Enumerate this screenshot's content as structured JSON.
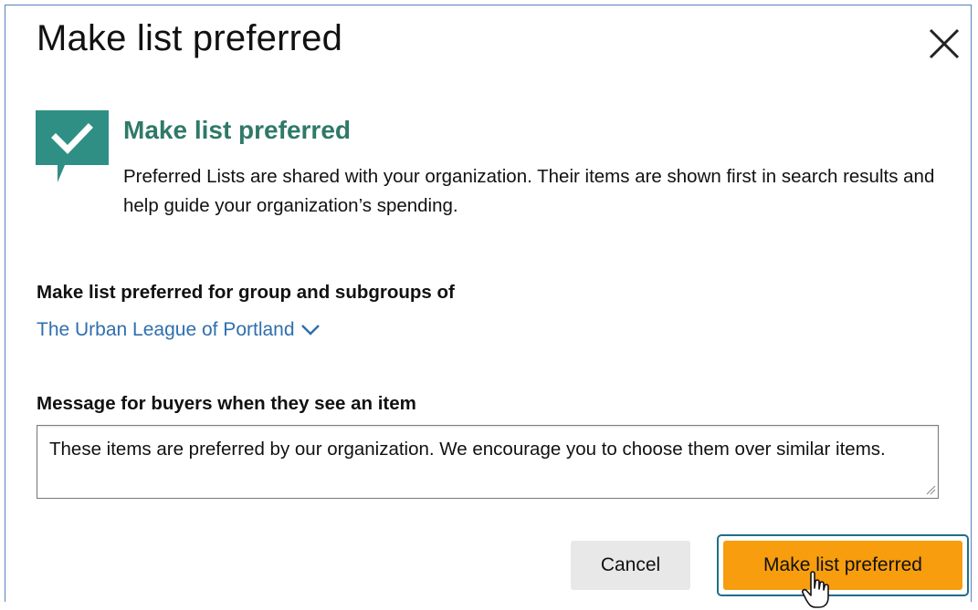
{
  "dialog": {
    "title": "Make list preferred"
  },
  "alert": {
    "icon": "check-speech-bubble-icon",
    "heading": "Make list preferred",
    "body": "Preferred Lists are shared with your organization. Their items are shown first in search results and help guide your organization’s spending."
  },
  "group": {
    "label": "Make list preferred for group and subgroups of",
    "selected": "The Urban League of Portland"
  },
  "message": {
    "label": "Message for buyers when they see an item",
    "value": "These items are preferred by our organization. We encourage you to choose them over similar items."
  },
  "buttons": {
    "cancel": "Cancel",
    "submit": "Make list preferred"
  },
  "colors": {
    "accent": "#2f7968",
    "link": "#2f6fae",
    "primary_button": "#f79d0e",
    "focus_ring": "#1f6e87",
    "dialog_border": "#5a7fc0"
  }
}
